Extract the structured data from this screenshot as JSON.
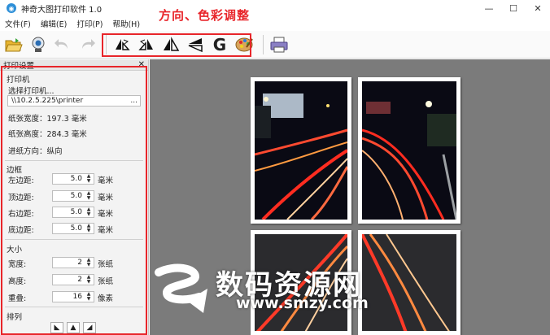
{
  "window": {
    "title": "神奇大图打印软件 1.0",
    "controls": [
      "minimize-icon",
      "maximize-icon",
      "close-icon"
    ]
  },
  "menu": [
    "文件(F)",
    "编辑(E)",
    "打印(P)",
    "帮助(H)"
  ],
  "annotation": {
    "text": "方向、色彩调整",
    "color": "#e8252a"
  },
  "toolbar": {
    "buttons": [
      "open-folder-icon",
      "webcam-icon",
      "undo-icon",
      "redo-icon",
      "rotate-left-icon",
      "rotate-right-icon",
      "flip-horizontal-icon",
      "flip-vertical-icon",
      "grayscale-icon",
      "color-palette-icon",
      "printer-icon"
    ],
    "g_label": "G"
  },
  "panel": {
    "title": "打印设置",
    "printer_section": "打印机",
    "select_printer": "选择打印机...",
    "printer_path": "\\\\10.2.5.225\\printer",
    "browse": "...",
    "paper_width": "纸张宽度：197.3 毫米",
    "paper_height": "纸张高度：284.3 毫米",
    "feed_direction": "进纸方向：纵向",
    "margin_section": "边框",
    "margins": [
      {
        "label": "左边距:",
        "value": "5.0",
        "unit": "毫米"
      },
      {
        "label": "顶边距:",
        "value": "5.0",
        "unit": "毫米"
      },
      {
        "label": "右边距:",
        "value": "5.0",
        "unit": "毫米"
      },
      {
        "label": "底边距:",
        "value": "5.0",
        "unit": "毫米"
      }
    ],
    "size_section": "大小",
    "sizes": [
      {
        "label": "宽度:",
        "value": "2",
        "unit": "张纸"
      },
      {
        "label": "高度:",
        "value": "2",
        "unit": "张纸"
      },
      {
        "label": "重叠:",
        "value": "16",
        "unit": "像素"
      }
    ],
    "arrange_section": "排列"
  },
  "watermark": {
    "main": "数码资源网",
    "url": "www.smzy.com"
  }
}
